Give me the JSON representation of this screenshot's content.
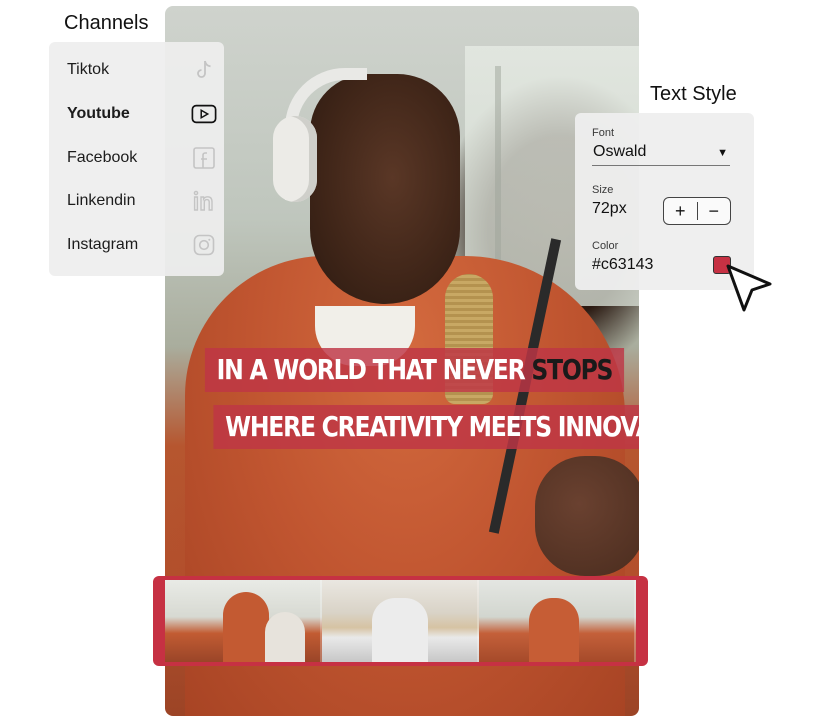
{
  "channels": {
    "title": "Channels",
    "items": [
      {
        "label": "Tiktok",
        "icon": "tiktok-icon",
        "active": false
      },
      {
        "label": "Youtube",
        "icon": "youtube-icon",
        "active": true
      },
      {
        "label": "Facebook",
        "icon": "facebook-icon",
        "active": false
      },
      {
        "label": "Linkendin",
        "icon": "linkedin-icon",
        "active": false
      },
      {
        "label": "Instagram",
        "icon": "instagram-icon",
        "active": false
      }
    ]
  },
  "text_style": {
    "title": "Text Style",
    "font_label": "Font",
    "font_value": "Oswald",
    "size_label": "Size",
    "size_value": "72px",
    "increase": "+",
    "decrease": "−",
    "color_label": "Color",
    "color_value": "#c63143"
  },
  "captions": {
    "line1_main": "IN A WORLD THAT NEVER ",
    "line1_highlight": "STOPS",
    "line2": "WHERE CREATIVITY MEETS INNOVATION"
  },
  "colors": {
    "accent": "#c63143",
    "caption_bg": "#be3646",
    "panel_bg": "#eeeeee"
  }
}
